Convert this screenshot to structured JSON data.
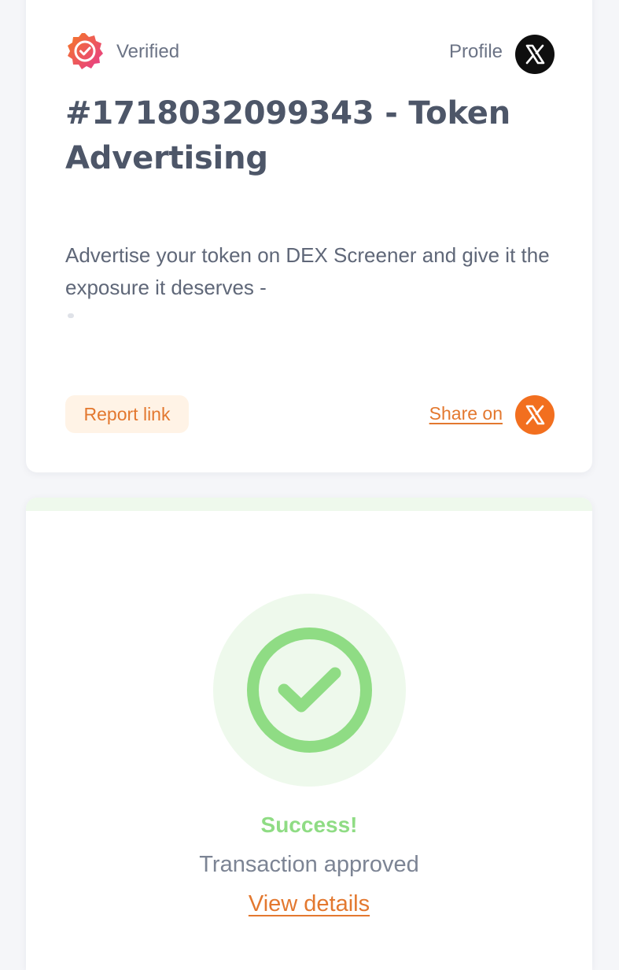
{
  "header": {
    "verified_label": "Verified",
    "verified_icon": "verified-badge-icon",
    "profile_label": "Profile",
    "profile_icon": "x-logo-icon"
  },
  "post": {
    "title": "#1718032099343 - Token Advertising",
    "description": "Advertise your token on DEX Screener and give it the exposure it deserves -"
  },
  "actions": {
    "report_label": "Report link",
    "share_label": "Share on",
    "share_icon": "x-logo-icon"
  },
  "status": {
    "icon": "check-circle-icon",
    "title": "Success!",
    "message": "Transaction approved",
    "details_label": "View details"
  },
  "colors": {
    "accent_orange": "#e3782f",
    "success_green": "#8fdc84",
    "badge_gradient": [
      "#f26a2a",
      "#e8418a"
    ],
    "text_dark": "#4d5668"
  }
}
